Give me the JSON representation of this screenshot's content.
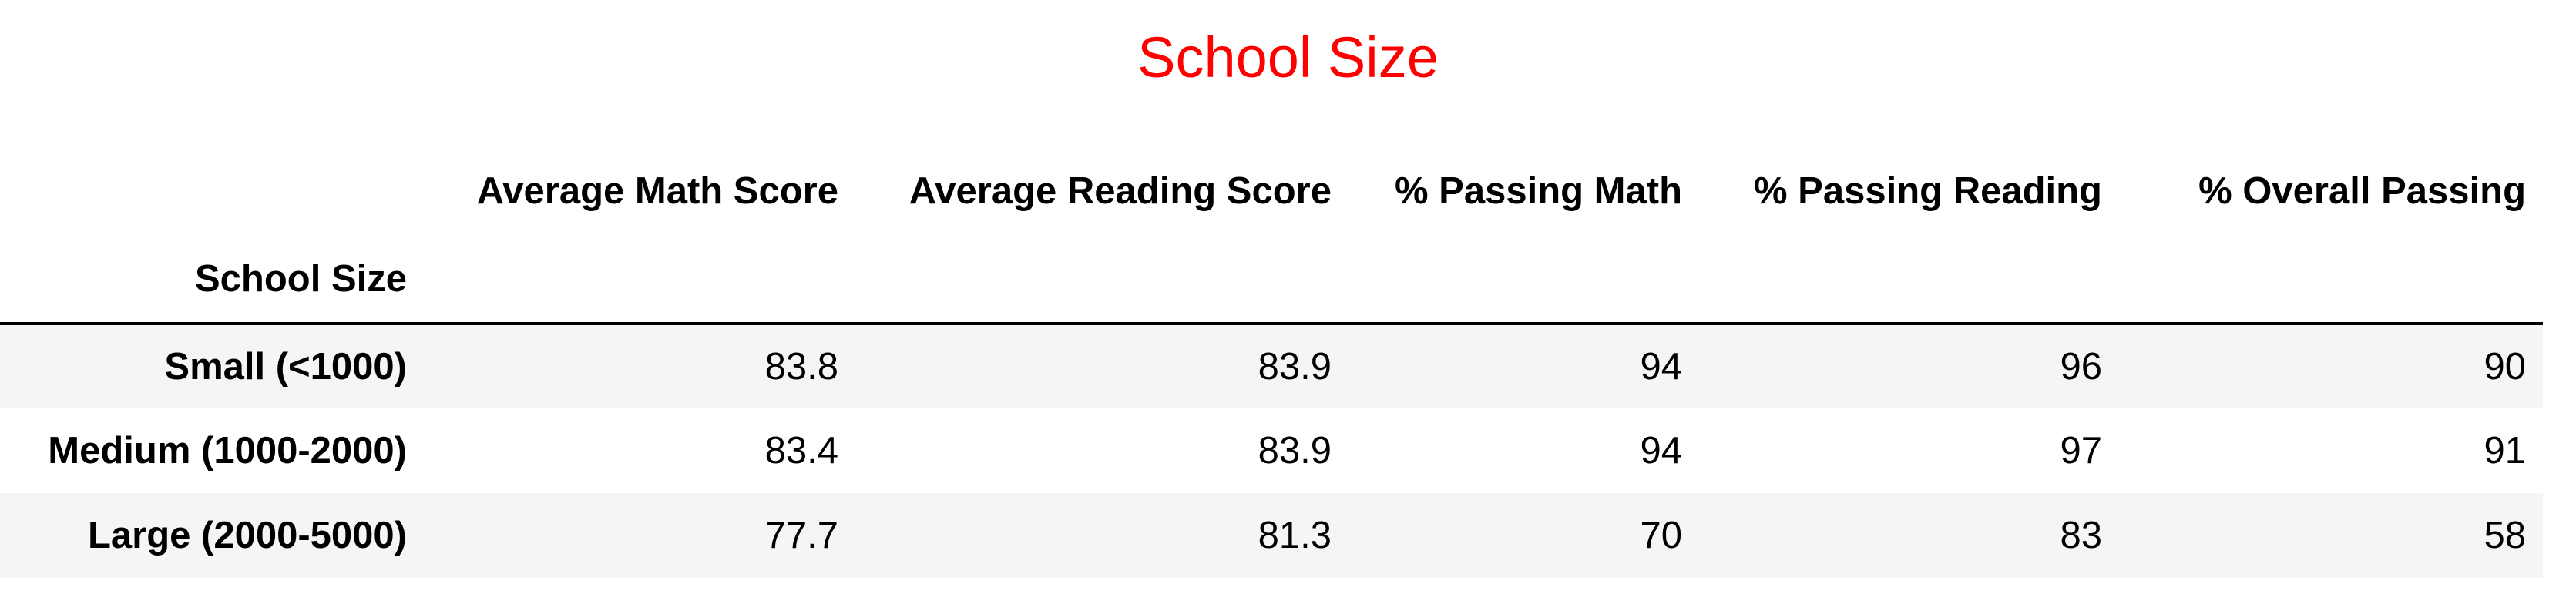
{
  "title": "School Size",
  "colors": {
    "title": "#ff0000",
    "stripe": "#f5f5f5"
  },
  "table": {
    "index_name": "School Size",
    "columns": [
      "Average Math Score",
      "Average Reading Score",
      "% Passing Math",
      "% Passing Reading",
      "% Overall Passing"
    ],
    "rows": [
      {
        "label": "Small (<1000)",
        "values": [
          "83.8",
          "83.9",
          "94",
          "96",
          "90"
        ]
      },
      {
        "label": "Medium (1000-2000)",
        "values": [
          "83.4",
          "83.9",
          "94",
          "97",
          "91"
        ]
      },
      {
        "label": "Large (2000-5000)",
        "values": [
          "77.7",
          "81.3",
          "70",
          "83",
          "58"
        ]
      }
    ]
  }
}
